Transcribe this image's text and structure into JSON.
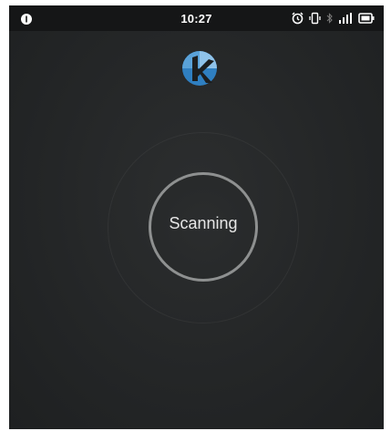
{
  "status_bar": {
    "time": "10:27",
    "icons": [
      "notification-icon",
      "alarm-icon",
      "vibrate-icon",
      "bluetooth-icon",
      "signal-icon",
      "battery-icon"
    ]
  },
  "app": {
    "logo": "k-logo",
    "scan_button_label": "Scanning"
  },
  "colors": {
    "background": "#242627",
    "status_bar": "#151617",
    "ring": "#8e9090",
    "logo_blue": "#2f7fc1"
  }
}
